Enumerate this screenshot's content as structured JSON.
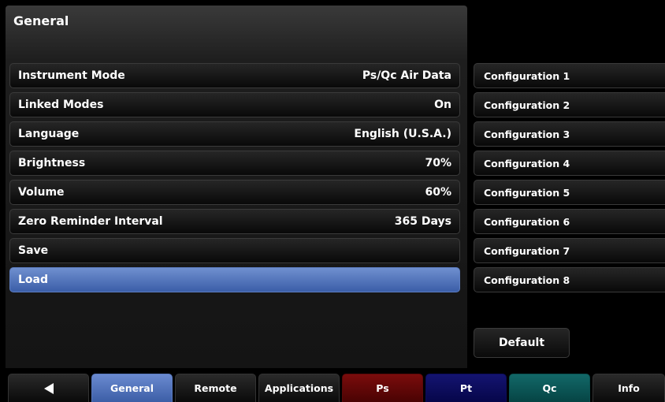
{
  "page": {
    "title": "General"
  },
  "settings": [
    {
      "label": "Instrument Mode",
      "value": "Ps/Qc Air Data",
      "selected": false
    },
    {
      "label": "Linked Modes",
      "value": "On",
      "selected": false
    },
    {
      "label": "Language",
      "value": "English (U.S.A.)",
      "selected": false
    },
    {
      "label": "Brightness",
      "value": "70%",
      "selected": false
    },
    {
      "label": "Volume",
      "value": "60%",
      "selected": false
    },
    {
      "label": "Zero Reminder Interval",
      "value": "365 Days",
      "selected": false
    },
    {
      "label": "Save",
      "value": "",
      "selected": false
    },
    {
      "label": "Load",
      "value": "",
      "selected": true
    }
  ],
  "configurations": [
    "Configuration 1",
    "Configuration 2",
    "Configuration 3",
    "Configuration 4",
    "Configuration 5",
    "Configuration 6",
    "Configuration 7",
    "Configuration 8"
  ],
  "default_label": "Default",
  "tabs": {
    "back_icon": "back-arrow-icon",
    "general": "General",
    "remote": "Remote",
    "applications": "Applications",
    "ps": "Ps",
    "pt": "Pt",
    "qc": "Qc",
    "info": "Info"
  },
  "colors": {
    "selected": "#4a6db8",
    "ps_tab": "#6a0808",
    "pt_tab": "#0e0e60",
    "qc_tab": "#0e5a5a"
  }
}
